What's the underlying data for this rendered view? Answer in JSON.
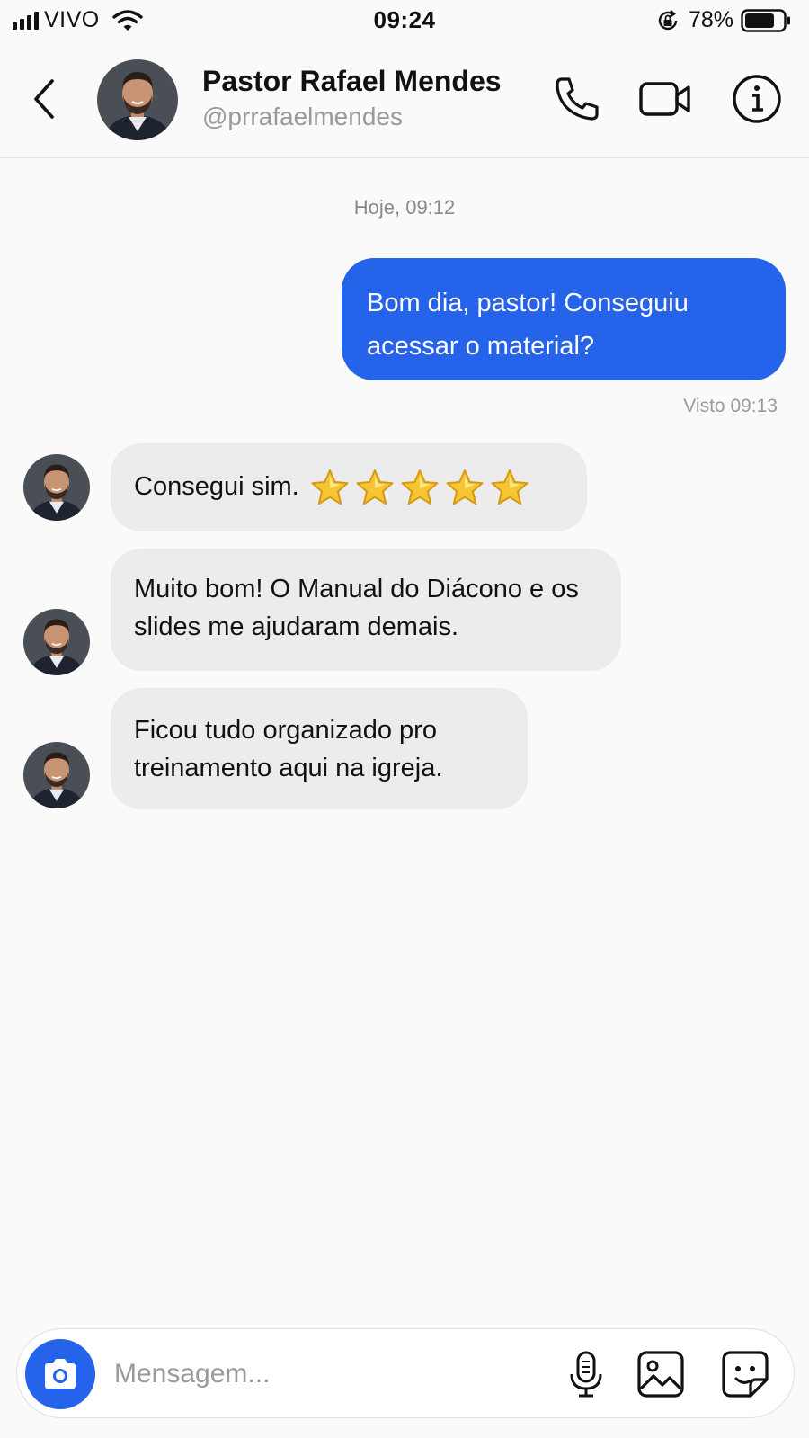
{
  "status_bar": {
    "carrier": "VIVO",
    "time": "09:24",
    "battery_percent": "78%",
    "battery_level": 0.78
  },
  "header": {
    "contact_name": "Pastor Rafael Mendes",
    "contact_handle": "@prrafaelmendes",
    "back_icon": "chevron-left-icon",
    "actions": [
      "phone-icon",
      "video-camera-icon",
      "info-icon"
    ]
  },
  "chat": {
    "date_label": "Hoje, 09:12",
    "outgoing": {
      "text": "Bom dia, pastor! Conseguiu acessar o material?",
      "color": "#2563eb"
    },
    "seen_label": "Visto 09:13",
    "incoming": [
      {
        "text": "Consegui sim.",
        "stars": 5
      },
      {
        "text": "Muito bom! O Manual do Diácono e os slides me ajudaram demais."
      },
      {
        "text": "Ficou tudo organizado pro treinamento aqui na igreja."
      }
    ]
  },
  "composer": {
    "placeholder": "Mensagem...",
    "icons": [
      "camera-icon",
      "microphone-icon",
      "gallery-icon",
      "sticker-icon"
    ],
    "accent": "#2563eb"
  }
}
